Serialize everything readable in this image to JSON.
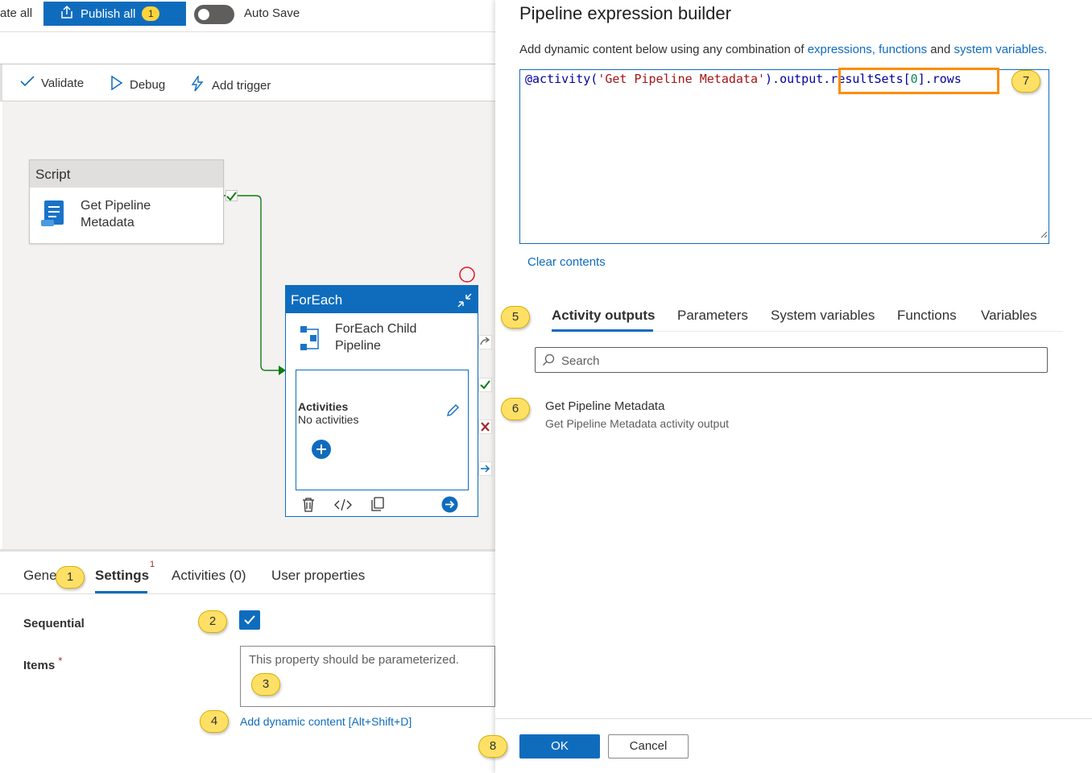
{
  "topbar": {
    "validate_all_fragment": "ate all",
    "publish_label": "Publish all",
    "publish_count": "1",
    "autosave_label": "Auto Save"
  },
  "toolbar": {
    "validate": "Validate",
    "debug": "Debug",
    "add_trigger": "Add trigger"
  },
  "canvas": {
    "script_node": {
      "header": "Script",
      "title_line1": "Get Pipeline",
      "title_line2": "Metadata"
    },
    "foreach_node": {
      "header": "ForEach",
      "title_line1": "ForEach Child",
      "title_line2": "Pipeline",
      "activities_label": "Activities",
      "no_activities": "No activities"
    }
  },
  "bottom_panel": {
    "tabs": [
      {
        "label": "Gene"
      },
      {
        "label": "Settings",
        "badge": "1"
      },
      {
        "label": "Activities (0)"
      },
      {
        "label": "User properties"
      }
    ],
    "sequential_label": "Sequential",
    "sequential_checked": true,
    "items_label": "Items",
    "items_required": "*",
    "items_placeholder": "This property should be parameterized.",
    "add_dynamic_link": "Add dynamic content [Alt+Shift+D]"
  },
  "expression_builder": {
    "title": "Pipeline expression builder",
    "subtitle_prefix": "Add dynamic content below using any combination of ",
    "subtitle_link1": "expressions, functions",
    "subtitle_and": " and ",
    "subtitle_link2": "system variables.",
    "expression": {
      "part1": "@activity(",
      "part2": "'Get Pipeline Metadata'",
      "part3": ").output.resultSets[",
      "part4": "0",
      "part5": "].rows"
    },
    "clear_contents": "Clear contents",
    "tabs": [
      "Activity outputs",
      "Parameters",
      "System variables",
      "Functions",
      "Variables"
    ],
    "search_placeholder": "Search",
    "item": {
      "title": "Get Pipeline Metadata",
      "subtitle": "Get Pipeline Metadata activity output"
    },
    "ok": "OK",
    "cancel": "Cancel"
  },
  "callouts": [
    "1",
    "2",
    "3",
    "4",
    "5",
    "6",
    "7",
    "8"
  ],
  "colors": {
    "accent": "#0f6cbd",
    "callout": "#ffe066",
    "highlight": "#ff8c00",
    "success": "#107c10",
    "error": "#a4262c"
  }
}
